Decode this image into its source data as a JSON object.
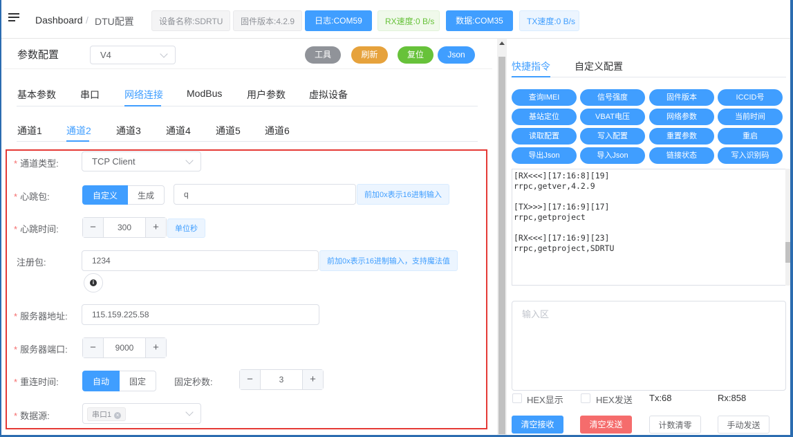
{
  "window": {
    "title_fragment": "DTU配置"
  },
  "header": {
    "breadcrumb": [
      "Dashboard",
      "DTU配置"
    ],
    "breadcrumb_sep": "/",
    "tags": {
      "device": "设备名称:SDRTU",
      "firmware": "固件版本:4.2.9",
      "log": "日志:COM59",
      "rx": "RX速度:0 B/s",
      "data": "数据:COM35",
      "tx": "TX速度:0 B/s"
    }
  },
  "config": {
    "title": "参数配置",
    "version": "V4",
    "buttons": {
      "tools": "工具",
      "refresh": "刷新",
      "reset": "复位",
      "json": "Json"
    },
    "tabs": [
      "基本参数",
      "串口",
      "网络连接",
      "ModBus",
      "用户参数",
      "虚拟设备"
    ],
    "active_tab": "网络连接",
    "channels": [
      "通道1",
      "通道2",
      "通道3",
      "通道4",
      "通道5",
      "通道6"
    ],
    "active_channel": "通道2"
  },
  "form": {
    "channel_type": {
      "label": "通道类型:",
      "value": "TCP Client"
    },
    "heartbeat": {
      "label": "心跳包:",
      "opt_custom": "自定义",
      "opt_gen": "生成",
      "value": "q",
      "hint": "前加0x表示16进制输入"
    },
    "heartbeat_time": {
      "label": "心跳时间:",
      "value": "300",
      "hint": "单位秒"
    },
    "register": {
      "label": "注册包:",
      "value": "1234",
      "hint": "前加0x表示16进制输入，支持魔法值"
    },
    "server_addr": {
      "label": "服务器地址:",
      "value": "115.159.225.58"
    },
    "server_port": {
      "label": "服务器端口:",
      "value": "9000"
    },
    "reconnect": {
      "label": "重连时间:",
      "opt_auto": "自动",
      "opt_fixed": "固定",
      "fixed_label": "固定秒数:",
      "fixed_value": "3"
    },
    "datasource": {
      "label": "数据源:",
      "chip": "串口1"
    }
  },
  "right": {
    "tabs": [
      "快捷指令",
      "自定义配置"
    ],
    "active_tab": "快捷指令",
    "quick": [
      "查询IMEI",
      "信号强度",
      "固件版本",
      "ICCID号",
      "基站定位",
      "VBAT电压",
      "网络参数",
      "当前时间",
      "读取配置",
      "写入配置",
      "重置参数",
      "重启",
      "导出Json",
      "导入Json",
      "链接状态",
      "写入识别码"
    ],
    "log": "[RX<<<][17:16:8][19]\nrrpc,getver,4.2.9\n\n[TX>>>][17:16:9][17]\nrrpc,getproject\n\n[RX<<<][17:16:9][23]\nrrpc,getproject,SDRTU",
    "input_placeholder": "输入区",
    "hex_show": "HEX显示",
    "hex_send": "HEX发送",
    "tx": "Tx:68",
    "rx": "Rx:858",
    "btn_clear_recv": "清空接收",
    "btn_clear_send": "清空发送",
    "btn_count_reset": "计数清零",
    "btn_manual_send": "手动发送"
  },
  "colors": {
    "primary": "#409eff",
    "danger": "#f56c6c",
    "success": "#67c23a",
    "warning": "#e6a23c",
    "highlight_box": "#e53935"
  }
}
